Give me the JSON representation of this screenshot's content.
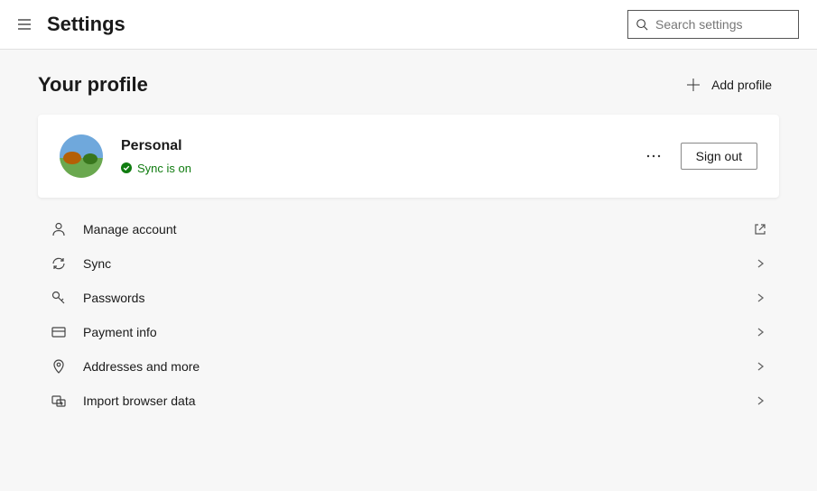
{
  "header": {
    "title": "Settings",
    "search_placeholder": "Search settings"
  },
  "section": {
    "title": "Your profile",
    "add_profile_label": "Add profile"
  },
  "profile": {
    "name": "Personal",
    "sync_status": "Sync is on",
    "signout_label": "Sign out"
  },
  "menu": {
    "items": [
      {
        "label": "Manage account"
      },
      {
        "label": "Sync"
      },
      {
        "label": "Passwords"
      },
      {
        "label": "Payment info"
      },
      {
        "label": "Addresses and more"
      },
      {
        "label": "Import browser data"
      }
    ]
  }
}
